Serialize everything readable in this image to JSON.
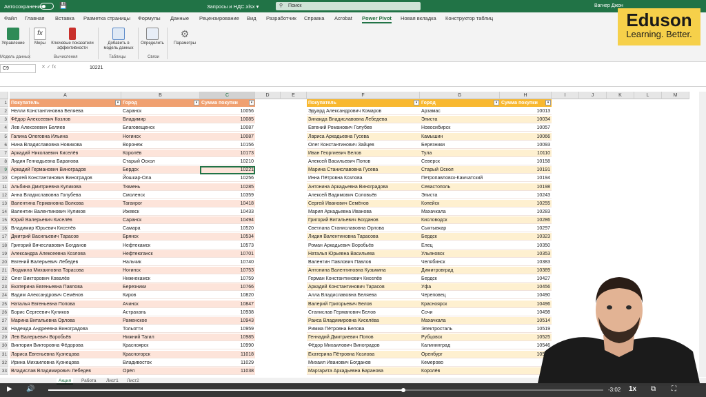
{
  "titlebar": {
    "autosave": "Автосохранение",
    "filename": "Запросы и НДС.xlsx ▾",
    "search_placeholder": "Поиск",
    "user": "Вагнер Джон"
  },
  "tabs": [
    "Файл",
    "Главная",
    "Вставка",
    "Разметка страницы",
    "Формулы",
    "Данные",
    "Рецензирование",
    "Вид",
    "Разработчик",
    "Справка",
    "Acrobat",
    "Power Pivot",
    "Новая вкладка",
    "Конструктор таблиц"
  ],
  "active_tab": "Power Pivot",
  "ribbon": {
    "buttons": [
      "Управление",
      "Меры",
      "Ключевые показатели эффективности",
      "Добавить в модель данных",
      "Определить",
      "Параметры"
    ],
    "groups": [
      "Модель данных",
      "Вычисления",
      "Таблицы",
      "Связи"
    ]
  },
  "formula_bar": {
    "name_box": "C9",
    "fx_icons": "✕  ✓  fx",
    "value": "10221"
  },
  "columns": [
    "A",
    "B",
    "C",
    "D",
    "E",
    "F",
    "G",
    "H",
    "I",
    "J",
    "K",
    "L",
    "M"
  ],
  "table1": {
    "headers": [
      "Покупатель",
      "Город",
      "Сумма покупки"
    ],
    "rows": [
      [
        "Нелли Константиновна Беляева",
        "Саранск",
        "10056"
      ],
      [
        "Фёдор Алексеевич Козлов",
        "Владимир",
        "10085"
      ],
      [
        "Лев Алексеевич Беляев",
        "Благовещенск",
        "10087"
      ],
      [
        "Галина Олеговна Ильина",
        "Ногинск",
        "10087"
      ],
      [
        "Нина Владиславовна Новикова",
        "Воронеж",
        "10156"
      ],
      [
        "Аркадий Николаевич Киселёв",
        "Королёв",
        "10173"
      ],
      [
        "Лидия Геннадьевна Баранова",
        "Старый Оскол",
        "10210"
      ],
      [
        "Аркадий Германович Виноградов",
        "Бердск",
        "10221"
      ],
      [
        "Сергей Константинович Виноградов",
        "Йошкар-Ола",
        "10256"
      ],
      [
        "Альбина Дмитриевна Куликова",
        "Тюмень",
        "10285"
      ],
      [
        "Анна Владиславовна Голубева",
        "Смоленск",
        "10359"
      ],
      [
        "Валентина Германовна Волкова",
        "Таганрог",
        "10418"
      ],
      [
        "Валентин Валентинович Куликов",
        "Ижевск",
        "10433"
      ],
      [
        "Юрий Валерьевич Киселёв",
        "Саранск",
        "10494"
      ],
      [
        "Владимир Юрьевич Киселёв",
        "Самара",
        "10520"
      ],
      [
        "Дмитрий Васильевич Тарасов",
        "Брянск",
        "10534"
      ],
      [
        "Григорий Вячеславович Богданов",
        "Нефтекамск",
        "10573"
      ],
      [
        "Александра Алексеевна Козлова",
        "Нефтеюганск",
        "10701"
      ],
      [
        "Евгений Валерьевич Лебедев",
        "Нальчик",
        "10740"
      ],
      [
        "Людмила Михаиловна Тарасова",
        "Ногинск",
        "10753"
      ],
      [
        "Олег Викторович Ковалёв",
        "Нижнекамск",
        "10759"
      ],
      [
        "Екатерина Евгеньевна Павлова",
        "Березники",
        "10766"
      ],
      [
        "Вадим Александрович Семёнов",
        "Киров",
        "10820"
      ],
      [
        "Наталья Евгеньевна Попова",
        "Ачинск",
        "10847"
      ],
      [
        "Борис Сергеевич Куликов",
        "Астрахань",
        "10938"
      ],
      [
        "Марина Витальевна Орлова",
        "Раменское",
        "10943"
      ],
      [
        "Надежда Андреевна Виноградова",
        "Тольятти",
        "10959"
      ],
      [
        "Лев Валерьевич Воробьёв",
        "Нижний Тагил",
        "10985"
      ],
      [
        "Виктория Викторовна Фёдорова",
        "Красноярск",
        "10990"
      ],
      [
        "Лариса Евгеньевна Кузнецова",
        "Красногорск",
        "11018"
      ],
      [
        "Ирина Михаиловна Кузнецова",
        "Владивосток",
        "11029"
      ],
      [
        "Владислав Владимирович Лебедев",
        "Орёл",
        "11038"
      ]
    ]
  },
  "table2": {
    "headers": [
      "Покупатель",
      "Город",
      "Сумма покупки"
    ],
    "rows": [
      [
        "Эдуард Александрович Комаров",
        "Арзамас",
        "10013"
      ],
      [
        "Зинаида Владиславовна Лебедева",
        "Элиста",
        "10034"
      ],
      [
        "Евгений Романович Голубев",
        "Новосибирск",
        "10057"
      ],
      [
        "Лариса Аркадьевна Гусева",
        "Камышин",
        "10066"
      ],
      [
        "Олег Константинович Зайцев",
        "Березники",
        "10093"
      ],
      [
        "Иван Георгиевич Белов",
        "Тула",
        "10110"
      ],
      [
        "Алексей Васильевич Попов",
        "Северск",
        "10158"
      ],
      [
        "Марина Станиславовна Гусева",
        "Старый Оскол",
        "10191"
      ],
      [
        "Инна Пётровна Козлова",
        "Петропавловск-Камчатский",
        "10194"
      ],
      [
        "Антонина Аркадьевна Виноградова",
        "Севастополь",
        "10198"
      ],
      [
        "Алексей Вадимович Соловьёв",
        "Элиста",
        "10243"
      ],
      [
        "Сергей Иванович Семёнов",
        "Копейск",
        "10255"
      ],
      [
        "Мария Аркадьевна Иванова",
        "Махачкала",
        "10283"
      ],
      [
        "Григорий Витальевич Богданов",
        "Кисловодск",
        "10286"
      ],
      [
        "Светлана Станиславовна Орлова",
        "Сыктывкар",
        "10297"
      ],
      [
        "Лидия Валентиновна Тарасова",
        "Бердск",
        "10323"
      ],
      [
        "Роман Аркадьевич Воробьёв",
        "Елец",
        "10350"
      ],
      [
        "Наталья Юрьевна Васильева",
        "Ульяновск",
        "10353"
      ],
      [
        "Валентин Павлович Павлов",
        "Челябинск",
        "10383"
      ],
      [
        "Антонина Валентиновна Кузьмина",
        "Димитровград",
        "10389"
      ],
      [
        "Герман Константинович Киселёв",
        "Бердск",
        "10427"
      ],
      [
        "Аркадий Константинович Тарасов",
        "Уфа",
        "10456"
      ],
      [
        "Алла Владиславовна Беляева",
        "Череповец",
        "10490"
      ],
      [
        "Валерий Григорьевич Белов",
        "Красноярск",
        "10496"
      ],
      [
        "Станислав Германович Белов",
        "Сочи",
        "10498"
      ],
      [
        "Раиса Владимировна Киселёва",
        "Махачкала",
        "10514"
      ],
      [
        "Римма Пётровна Белова",
        "Электросталь",
        "10519"
      ],
      [
        "Геннадий Дмитриевич Попов",
        "Рубцовск",
        "10525"
      ],
      [
        "Фёдор Михаилович Виноградов",
        "Калининград",
        "10546"
      ],
      [
        "Екатерина Пётровна Козлова",
        "Оренбург",
        "10573"
      ],
      [
        "Михаил Иванович Богданов",
        "Кемерово",
        "10"
      ],
      [
        "Маргарита Аркадьевна Баранова",
        "Королёв",
        ""
      ]
    ]
  },
  "sheet_tabs": [
    "Акция",
    "Работа",
    "Лист1",
    "Лист2"
  ],
  "player": {
    "time": "-3:02",
    "speed": "1x",
    "progress_fraction": 0.64
  },
  "logo": {
    "line1": "Eduson",
    "line2": "Learning. Better."
  },
  "colors": {
    "excel_green": "#217346",
    "table1_header": "#f0a070",
    "table1_band": "#fde4da",
    "table2_header": "#f8b830",
    "table2_band": "#fef0d0",
    "logo_bg": "#f6d04a"
  }
}
